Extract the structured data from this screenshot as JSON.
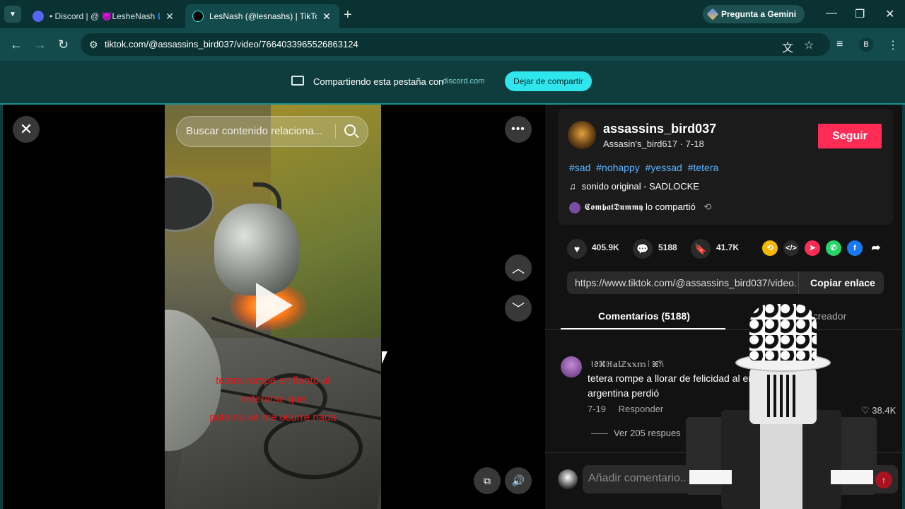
{
  "browser": {
    "tabs": [
      {
        "title": "• Discord | @ 😈LesheNash 🌀",
        "active": false
      },
      {
        "title": "LesNash (@lesnashs) | TikTok",
        "active": true
      }
    ],
    "new_tab": "+",
    "gemini_label": "Pregunta a Gemini",
    "url": "tiktok.com/@assassins_bird037/video/7664033965526863124",
    "profile_initial": "B",
    "window_controls": {
      "minimize": "—",
      "restore": "❐",
      "close": "✕"
    }
  },
  "sharing": {
    "text": "Compartiendo esta pestaña con",
    "domain": "discord.com",
    "stop_label": "Dejar de compartir"
  },
  "video": {
    "search_placeholder": "Buscar contenido relaciona...",
    "caption_lines": [
      "tetera rompe en llanto al",
      "enterarse que",
      "puta no se me ocurre nada"
    ]
  },
  "post": {
    "username": "assassins_bird037",
    "subline": "Assasin's_bird617 · 7-18",
    "follow_label": "Seguir",
    "hashtags": [
      "#sad",
      "#nohappy",
      "#yessad",
      "#tetera"
    ],
    "sound": "sonido original - SADLOCKE",
    "shared_by": "𝕮𝖔𝖒𝖇𝖆𝖙𝕯𝖚𝖒𝖒𝖞 lo compartió",
    "likes": "405.9K",
    "comments_count": "5188",
    "saves": "41.7K",
    "link": "https://www.tiktok.com/@assassins_bird037/video...",
    "copy_link_label": "Copiar enlace"
  },
  "tabs": {
    "comments": "Comentarios (5188)",
    "creator": "el creador"
  },
  "comment": {
    "user": "⌇ϑ⌘ℍ𝕒𝕝ℤ𝕩𝕩𝕞꒐ꕤ𐙚",
    "text": "tetera rompe a llorar de felicidad al enterarse que argentina perdió",
    "date": "7-19",
    "reply_label": "Responder",
    "likes": "38.4K",
    "view_replies": "Ver 205 respues"
  },
  "composer": {
    "placeholder": "Añadir comentario..."
  },
  "colors": {
    "accent_follow": "#fe2c55",
    "hashtag": "#5bb4ff",
    "caption": "#e01818",
    "browser_teal": "#134a4b",
    "share_button": "#2ee6ec"
  },
  "icons": [
    "close-icon",
    "more-icon",
    "chevron-up-icon",
    "chevron-down-icon",
    "play-icon",
    "search-icon",
    "heart-icon",
    "comment-icon",
    "bookmark-icon",
    "volume-icon",
    "pip-icon"
  ]
}
